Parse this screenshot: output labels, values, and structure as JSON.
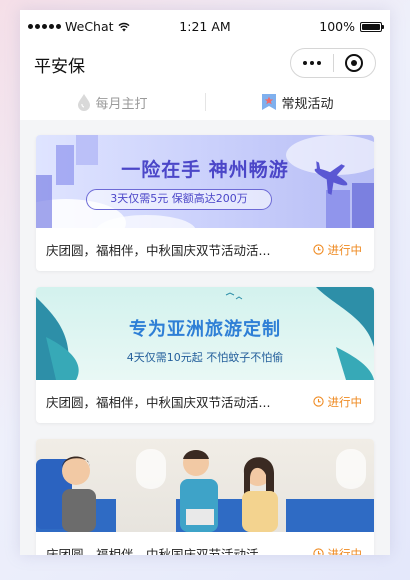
{
  "status_bar": {
    "carrier": "WeChat",
    "time": "1:21 AM",
    "battery": "100%"
  },
  "navbar": {
    "title": "平安保"
  },
  "tabs": [
    {
      "label": "每月主打",
      "icon": "drop-icon",
      "active": false
    },
    {
      "label": "常规活动",
      "icon": "star-badge-icon",
      "active": true
    }
  ],
  "cards": [
    {
      "banner_headline": "一险在手 神州畅游",
      "banner_sub": "3天仅需5元  保额高达200万",
      "desc": "庆团圆，福相伴，中秋国庆双节活动活...",
      "status": "进行中"
    },
    {
      "banner_headline": "专为亚洲旅游定制",
      "banner_sub": "4天仅需10元起  不怕蚊子不怕偷",
      "desc": "庆团圆，福相伴，中秋国庆双节活动活...",
      "status": "进行中"
    },
    {
      "desc": "庆团圆，福相伴，中秋国庆双节活动活...",
      "status": "进行中"
    }
  ],
  "colors": {
    "status_orange": "#ef8a21",
    "banner1_text": "#4b46c8",
    "banner2_text": "#2e7fd6"
  }
}
